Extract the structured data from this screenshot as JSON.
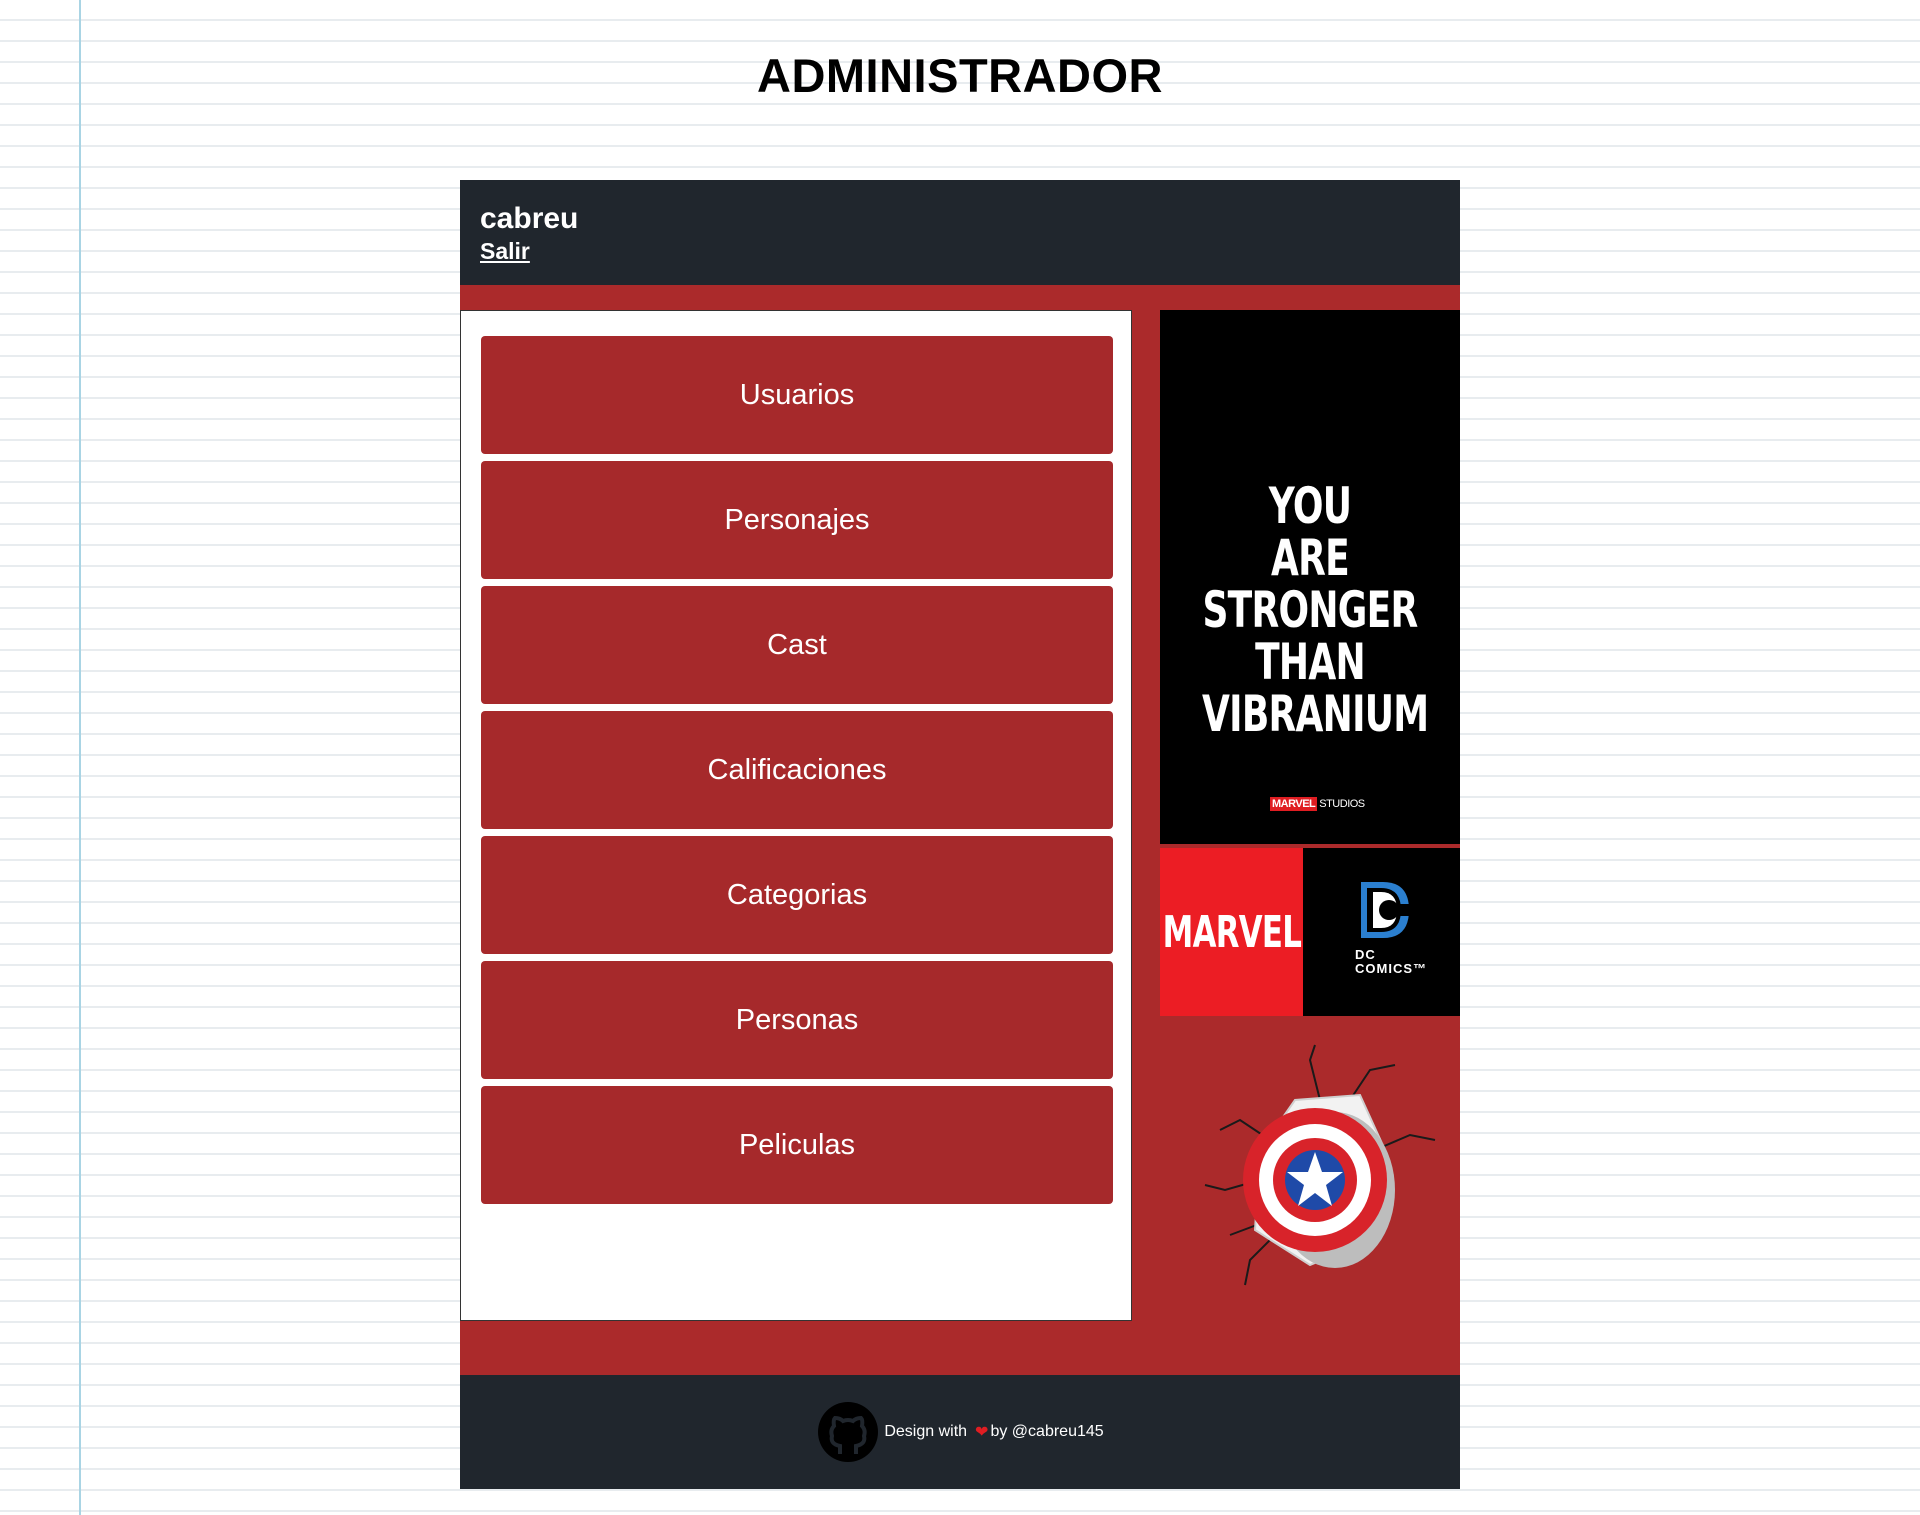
{
  "page": {
    "title": "ADMINISTRADOR"
  },
  "header": {
    "username": "cabreu",
    "logout_label": "Salir"
  },
  "menu": {
    "items": [
      {
        "label": "Usuarios"
      },
      {
        "label": "Personajes"
      },
      {
        "label": "Cast"
      },
      {
        "label": "Calificaciones"
      },
      {
        "label": "Categorias"
      },
      {
        "label": "Personas"
      },
      {
        "label": "Peliculas"
      }
    ]
  },
  "poster": {
    "lines": [
      "YOU",
      "ARE",
      "STRONGER",
      "THAN",
      "VIBRANIUM"
    ],
    "badge_brand": "MARVEL",
    "badge_studios": "STUDIOS"
  },
  "brands": {
    "marvel": "MARVEL",
    "dc": "DC\nCOMICS™"
  },
  "images": {
    "shield": "captain-america-shield-icon"
  },
  "footer": {
    "prefix": "Design with",
    "suffix": "by @cabreu145",
    "heart_icon": "heart-icon",
    "github_icon": "github-icon"
  },
  "colors": {
    "app_background": "#ab2a2b",
    "header_footer": "#20262d",
    "menu_button": "#a6292b",
    "marvel_red": "#ec1d24",
    "notebook_line": "#e8ecef",
    "margin_line": "#a9d4e4"
  }
}
